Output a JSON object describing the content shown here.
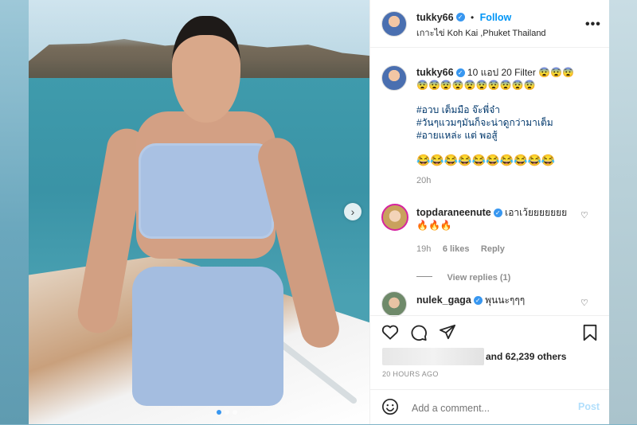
{
  "post": {
    "username": "tukky66",
    "follow_label": "Follow",
    "location": "เกาะไข่ Koh Kai ,Phuket Thailand",
    "more_icon": "more-horizontal-icon",
    "caption_line1": "10 แอป 20 Filter 😨😨😨",
    "caption_line2": "😨😨😨😨😨😨😨😨😨😨",
    "hashtag1": "#อวบ เต็มมือ จ๊ะพี่จ๋า",
    "hashtag2": "#วันๆแวมๆมันก็จะน่าดูกว่ามาเต็ม",
    "hashtag3": "#อายแหล่ะ แต่ พอสู้",
    "emoji_line": "😂😂😂😂😂😂😂😂😂😂",
    "time_short": "20h"
  },
  "comments": [
    {
      "username": "topdaraneenute",
      "text": "เอาเว้ยยยยยยย",
      "text2": "🔥🔥🔥",
      "time": "19h",
      "likes": "6 likes",
      "reply_label": "Reply",
      "view_replies": "View replies (1)"
    },
    {
      "username": "nulek_gaga",
      "text": "พุนนะๆๆๆ"
    }
  ],
  "likes_text": "and 62,239 others",
  "posted_ago": "20 HOURS AGO",
  "comment_placeholder": "Add a comment...",
  "post_button": "Post",
  "colors": {
    "accent": "#0095f6",
    "verified": "#3897f0",
    "text": "#262626",
    "muted": "#8e8e8e"
  }
}
